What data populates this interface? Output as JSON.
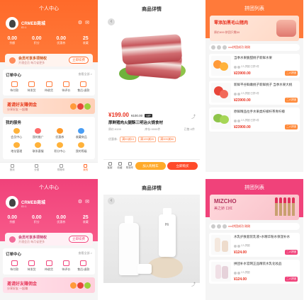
{
  "account": {
    "title": "个人中心",
    "username": "CRMEB商城",
    "user_tag": "ID:1",
    "stats": [
      {
        "value": "0.00",
        "label": "余额"
      },
      {
        "value": "0.00",
        "label": "积分"
      },
      {
        "value": "0.00",
        "label": "优惠券"
      },
      {
        "value": "25",
        "label": "收藏"
      }
    ],
    "vip_title": "会员可享多项特权",
    "vip_sub": "开通会员 每月省更多",
    "vip_button": "立即续费",
    "orders_title": "订单中心",
    "orders_more": "查看全部 >",
    "orders": [
      "待付款",
      "待发货",
      "待收货",
      "待评价",
      "售后/退款"
    ],
    "promo_title": "邀请好友赚佣金",
    "promo_sub": "分享好友 一起赚",
    "services_title": "我的服务",
    "services": [
      "会员中心",
      "我的推广",
      "优惠券",
      "收藏商品",
      "地址管理",
      "联系客服",
      "积分中心",
      "我的等级"
    ],
    "tabs": [
      "首页",
      "分类",
      "购物车",
      "我的"
    ]
  },
  "product": {
    "title": "商品详情",
    "back": "‹",
    "price": "¥199.00",
    "original_price": "¥ 199.00",
    "vip_label": "VIP",
    "vip_price": "¥100.00",
    "share": "⤴",
    "name": "厚鲜猪肉火腿酥三明治火锅食材",
    "original_label": "原价:¥199",
    "stock": "库存:9999件",
    "sold": "已售:0件",
    "tags_label": "优惠券:",
    "tags": [
      "满99减10",
      "满199减20",
      "满399减50"
    ],
    "bottom": [
      "客服",
      "收藏",
      "购物车"
    ],
    "cart_button": "加入购物车",
    "buy_button": "立即购买"
  },
  "list_orange": {
    "title": "拼团列表",
    "banner_line1": "零添加黑毛山猪肉",
    "banner_line2": "原价¥99 拼团只需59",
    "notice_prefix": "",
    "notice": "xxx拼团成功 刚刚",
    "items": [
      {
        "name": "当季水果脆甜桃子新鲜水果",
        "group": "2人拼团 已拼1件",
        "price": "¥23900.00",
        "btn": "二人拼团"
      },
      {
        "name": "新鲜平谷鲜嫩桃子新鲜桃子 当季水果大桃",
        "group": "2人拼团 已拼1件",
        "price": "¥23900.00",
        "btn": "二人拼团"
      },
      {
        "name": "原鲜精品拉手水果类柠檬柠茶青柠檬",
        "group": "2人拼团 已拼1件",
        "price": "¥23900.00",
        "btn": "二人拼团"
      }
    ]
  },
  "list_pink": {
    "title": "拼团列表",
    "banner_line1": "MIZCHO",
    "banner_line2": "美之娇 口红",
    "items": [
      {
        "name": "水乳护肤套装乳液+水精华粉水保湿补水",
        "group": "2人拼团",
        "price": "¥124.00",
        "btn": "二人拼团"
      },
      {
        "name": "拼团补水官网正品精装水乳化妆品",
        "group": "2人拼团",
        "price": "¥124.00",
        "btn": "二人拼团"
      }
    ]
  },
  "product_pink": {
    "title": "商品详情",
    "brand": "Hi"
  },
  "colors": {
    "orange": "#ff6a2a",
    "pink": "#f0427a",
    "price_red": "#e8301e"
  }
}
